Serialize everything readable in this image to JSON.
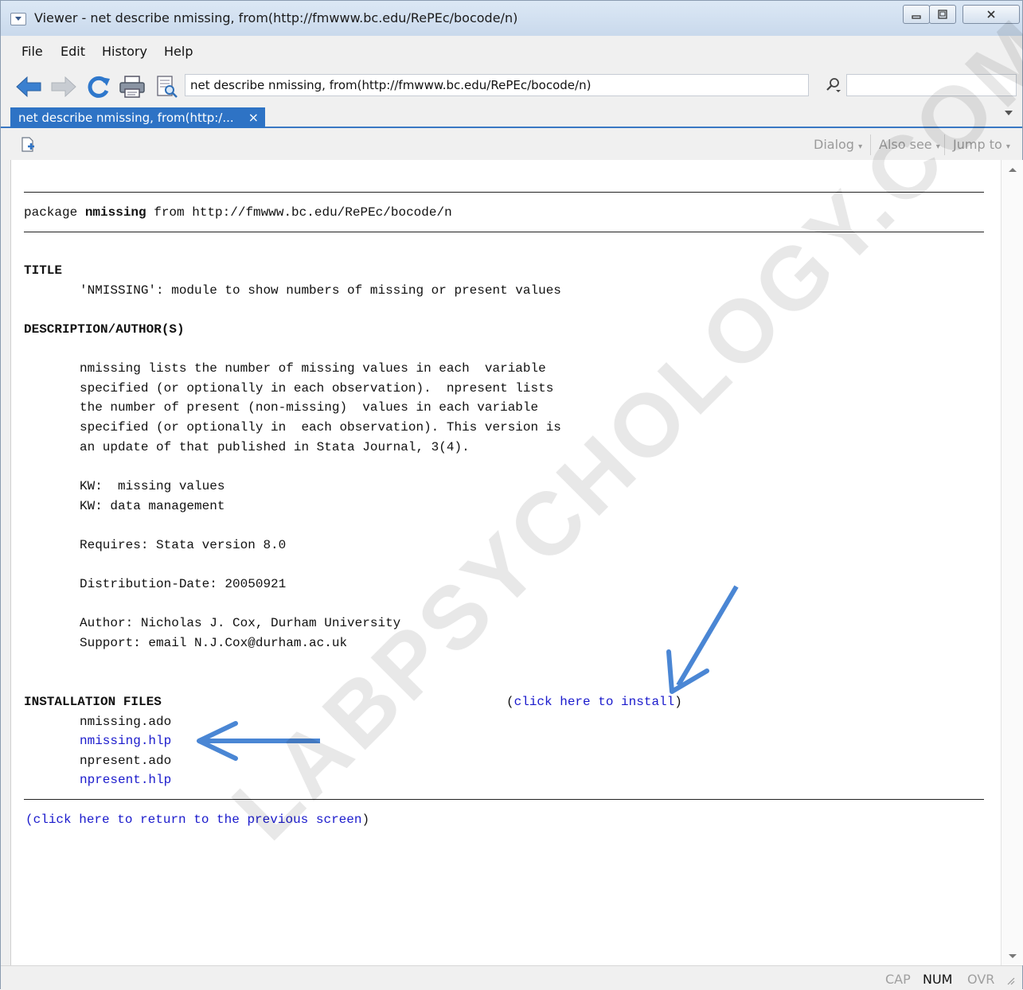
{
  "window": {
    "title": "Viewer - net describe nmissing, from(http://fmwww.bc.edu/RePEc/bocode/n)"
  },
  "menu": [
    "File",
    "Edit",
    "History",
    "Help"
  ],
  "toolbar": {
    "address": "net describe nmissing, from(http://fmwww.bc.edu/RePEc/bocode/n)",
    "search_value": ""
  },
  "tab": {
    "label": "net describe nmissing, from(http:/...",
    "close": "×"
  },
  "subtoolbar": {
    "dialog": "Dialog",
    "also_see": "Also see",
    "jump_to": "Jump to"
  },
  "content": {
    "package_line_prefix": "package ",
    "package_name": "nmissing",
    "package_line_suffix": " from http://fmwww.bc.edu/RePEc/bocode/n",
    "title_heading": "TITLE",
    "title_text": "'NMISSING': module to show numbers of missing or present values",
    "desc_heading": "DESCRIPTION/AUTHOR(S)",
    "desc_lines": [
      "nmissing lists the number of missing values in each  variable",
      "specified (or optionally in each observation).  npresent lists",
      "the number of present (non-missing)  values in each variable",
      "specified (or optionally in  each observation). This version is",
      "an update of that published in Stata Journal, 3(4)."
    ],
    "kw1": "KW:  missing values",
    "kw2": "KW: data management",
    "requires": "Requires: Stata version 8.0",
    "distribution": "Distribution-Date: 20050921",
    "author": "Author: Nicholas J. Cox, Durham University",
    "support": "Support: email N.J.Cox@durham.ac.uk",
    "install_heading": "INSTALLATION FILES",
    "install_paren_open": "(",
    "install_link": "click here to install",
    "install_paren_close": ")",
    "files": [
      {
        "name": "nmissing.ado"
      },
      {
        "name": "nmissing.hlp"
      },
      {
        "name": "npresent.ado"
      },
      {
        "name": "npresent.hlp"
      }
    ],
    "return_paren_open": "(",
    "return_link": "click here to return to the previous screen",
    "return_paren_close": ")"
  },
  "status": {
    "cap": "CAP",
    "num": "NUM",
    "ovr": "OVR"
  },
  "watermark": "LABPSYCHOLOGY.COM",
  "colors": {
    "link": "#1a1acc",
    "tab": "#2e73c5",
    "arrow": "#4a86d4"
  },
  "icons": [
    "back-arrow-icon",
    "forward-arrow-icon",
    "refresh-icon",
    "print-icon",
    "find-icon",
    "search-icon",
    "new-viewer-icon"
  ]
}
